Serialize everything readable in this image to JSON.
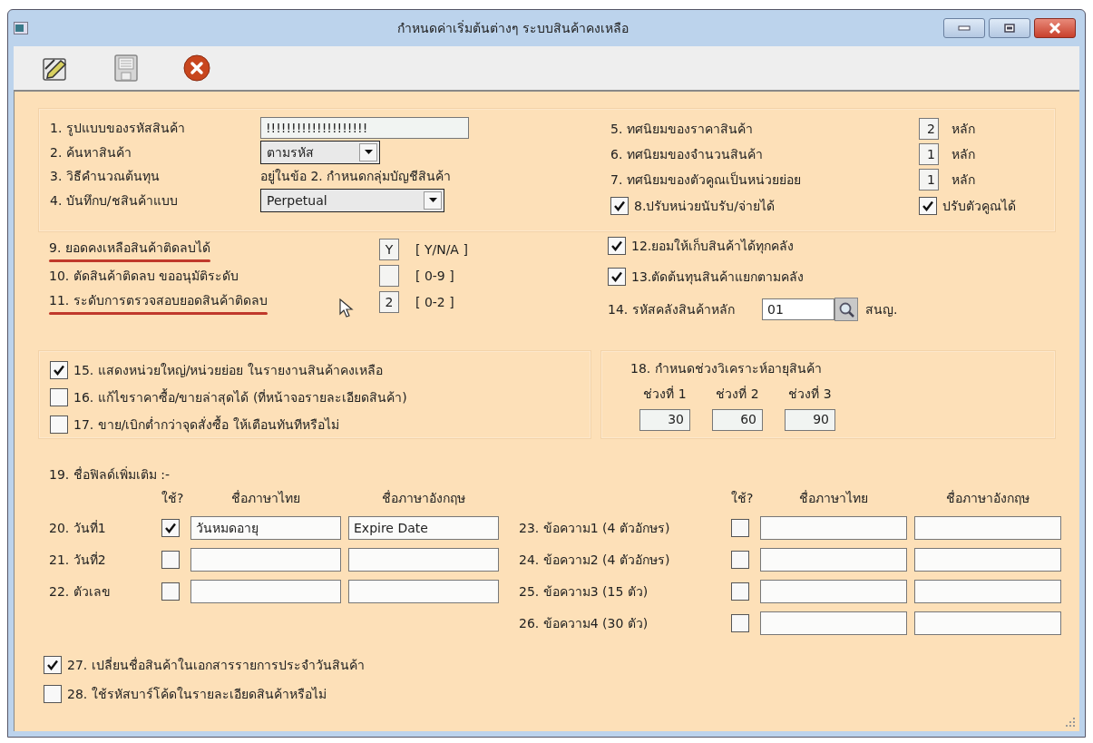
{
  "window": {
    "title": "กำหนดค่าเริ่มต้นต่างๆ ระบบสินค้าคงเหลือ"
  },
  "toolbar": [
    {
      "kind": "edit"
    },
    {
      "kind": "save"
    },
    {
      "kind": "cancel"
    }
  ],
  "general": {
    "left_rows": [
      {
        "label": "1. รูปแบบของรหัสสินค้า",
        "kind": "text",
        "value": "!!!!!!!!!!!!!!!!!!!!"
      },
      {
        "label": "2. ค้นหาสินค้า",
        "kind": "dropdown",
        "value": "ตามรหัส"
      },
      {
        "label": "3. วิธีคำนวณต้นทุน",
        "kind": "static",
        "value": "อยู่ในข้อ 2. กำหนดกลุ่มบัญชีสินค้า"
      },
      {
        "label": "4. บันทึกบ/ชสินค้าแบบ",
        "kind": "dropdown",
        "value": "Perpetual"
      }
    ],
    "right_rows": [
      {
        "label": "5. ทศนิยมของราคาสินค้า",
        "value": "2",
        "unit": "หลัก"
      },
      {
        "label": "6. ทศนิยมของจำนวนสินค้า",
        "value": "1",
        "unit": "หลัก"
      },
      {
        "label": "7. ทศนิยมของตัวคูณเป็นหน่วยย่อย",
        "value": "1",
        "unit": "หลัก"
      }
    ],
    "checks": [
      {
        "label": "8.ปรับหน่วยนับรับ/จ่ายได้",
        "checked": true
      },
      {
        "label": "ปรับตัวคูณได้",
        "checked": true
      }
    ]
  },
  "negative_stock": [
    {
      "label": "9. ยอดคงเหลือสินค้าติดลบได้",
      "value": "Y",
      "hint": "[ Y/N/A ]",
      "underlined": true
    },
    {
      "label": "10. ตัดสินค้าติดลบ ขออนุมัติระดับ",
      "hint": "[ 0-9 ]",
      "underlined": false
    },
    {
      "label": "11. ระดับการตรวจสอบยอดสินค้าติดลบ",
      "value": "2",
      "hint": "[ 0-2 ]",
      "underlined": true
    }
  ],
  "warehouse": {
    "checks": [
      {
        "label": "12.ยอมให้เก็บสินค้าได้ทุกคลัง",
        "checked": true
      },
      {
        "label": "13.ตัดต้นทุนสินค้าแยกตามคลัง",
        "checked": true
      }
    ],
    "main": {
      "label": "14. รหัสคลังสินค้าหลัก",
      "value": "01",
      "name": "สนญ."
    }
  },
  "report_options": [
    {
      "label": "15. แสดงหน่วยใหญ่/หน่วยย่อย ในรายงานสินค้าคงเหลือ",
      "checked": true
    },
    {
      "label": "16. แก้ไขราคาซื้อ/ขายล่าสุดได้ (ที่หน้าจอรายละเอียดสินค้า)",
      "checked": false
    },
    {
      "label": "17. ขาย/เบิกต่ำกว่าจุดสั่งซื้อ ให้เตือนทันทีหรือไม่",
      "checked": false
    }
  ],
  "aging": {
    "title": "18. กำหนดช่วงวิเคราะห์อายุสินค้า",
    "periods": [
      {
        "label": "ช่วงที่ 1",
        "value": "30"
      },
      {
        "label": "ช่วงที่ 2",
        "value": "60"
      },
      {
        "label": "ช่วงที่ 3",
        "value": "90"
      }
    ]
  },
  "extra_fields": {
    "title": "19. ชื่อฟิลด์เพิ่มเติม :-",
    "left": {
      "headers": [
        "ใช้?",
        "ชื่อภาษาไทย",
        "ชื่อภาษาอังกฤษ"
      ],
      "rows": [
        {
          "label": "20. วันที่1",
          "checked": true,
          "thai_name": "วันหมดอายุ",
          "english_name": "Expire Date"
        },
        {
          "label": "21. วันที่2",
          "checked": false
        },
        {
          "label": "22. ตัวเลข",
          "checked": false
        }
      ]
    },
    "right": {
      "headers": [
        "ใช้?",
        "ชื่อภาษาไทย",
        "ชื่อภาษาอังกฤษ"
      ],
      "rows": [
        {
          "label": "23. ข้อความ1 (4 ตัวอักษร)",
          "checked": false
        },
        {
          "label": "24. ข้อความ2 (4 ตัวอักษร)",
          "checked": false
        },
        {
          "label": "25. ข้อความ3 (15 ตัว)",
          "checked": false
        },
        {
          "label": "26. ข้อความ4 (30 ตัว)",
          "checked": false
        }
      ]
    }
  },
  "bottom_options": [
    {
      "label": "27. เปลี่ยนชื่อสินค้าในเอกสารรายการประจำวันสินค้า",
      "checked": true
    },
    {
      "label": "28. ใช้รหัสบาร์โค้ดในรายละเอียดสินค้าหรือไม่",
      "checked": false
    }
  ]
}
